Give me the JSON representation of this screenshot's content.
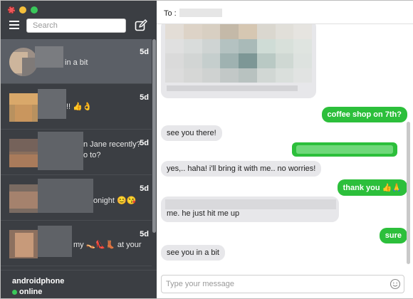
{
  "window": {
    "traffic": [
      "close",
      "minimize",
      "zoom"
    ]
  },
  "sidebar": {
    "search_placeholder": "Search",
    "conversations": [
      {
        "snippet": "in a bit",
        "date": "5d",
        "active": true
      },
      {
        "snippet": "!! 👍👌",
        "date": "5d",
        "active": false
      },
      {
        "snippet": "n Jane recently?",
        "snippet2": "o to?",
        "date": "5d",
        "active": false
      },
      {
        "snippet": "onight 😊😘",
        "date": "5d",
        "active": false
      },
      {
        "snippet": "my 👡👠👢 at your",
        "date": "5d",
        "active": false
      }
    ],
    "user": {
      "name": "androidphone",
      "status": "online"
    }
  },
  "header": {
    "to_label": "To :"
  },
  "messages": [
    {
      "dir": "out",
      "text": "coffee shop on 7th?"
    },
    {
      "dir": "in",
      "text": "see you there!"
    },
    {
      "dir": "in",
      "text": "yes,.. haha! i'll bring it with me.. no worries!"
    },
    {
      "dir": "out",
      "text": "thank you 👍🙏"
    },
    {
      "dir": "in",
      "text": "me. he just hit me up"
    },
    {
      "dir": "out",
      "text": "sure"
    },
    {
      "dir": "in",
      "text": "see you in a bit"
    }
  ],
  "composer": {
    "placeholder": "Type your message"
  },
  "colors": {
    "sidebar_bg": "#3b3e43",
    "outgoing": "#2cbf3b",
    "incoming": "#e7e7ea"
  }
}
